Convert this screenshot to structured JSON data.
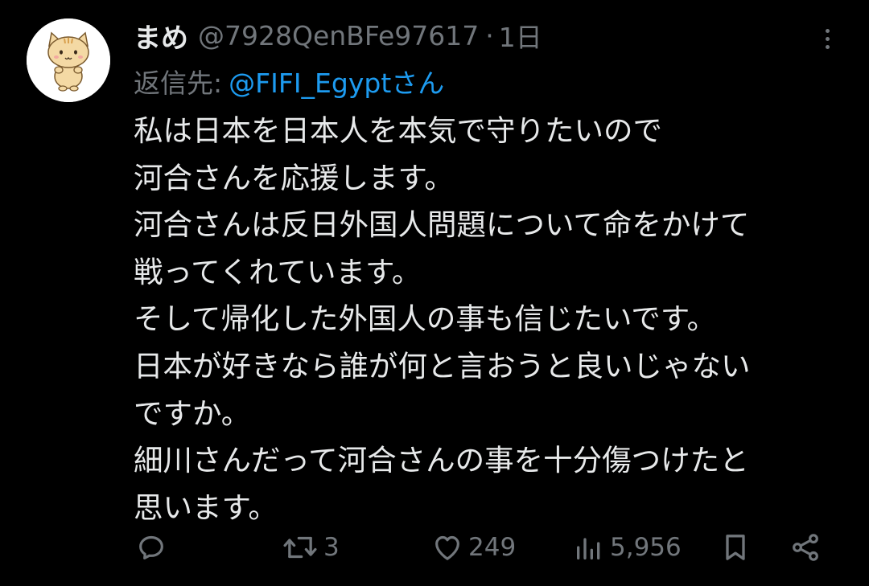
{
  "author": {
    "display_name": "まめ",
    "handle": "@7928QenBFe97617",
    "separator": "·",
    "time": "1日"
  },
  "reply": {
    "label": "返信先:",
    "user": "@FIFI_Egyptさん"
  },
  "body_lines": [
    "私は日本を日本人を本気で守りたいので",
    "河合さんを応援します。",
    "河合さんは反日外国人問題について命をかけて",
    "戦ってくれています。",
    "そして帰化した外国人の事も信じたいです。",
    "日本が好きなら誰が何と言おうと良いじゃない",
    "ですか。",
    "細川さんだって河合さんの事を十分傷つけたと",
    "思います。"
  ],
  "stats": {
    "replies": "",
    "retweets": "3",
    "likes": "249",
    "views": "5,956"
  },
  "icons": {
    "avatar": "cat-avatar-icon",
    "more": "more-vertical-icon",
    "reply": "reply-icon",
    "retweet": "retweet-icon",
    "like": "heart-icon",
    "views": "views-icon",
    "bookmark": "bookmark-icon",
    "share": "share-icon"
  },
  "colors": {
    "background": "#000000",
    "primary_text": "#e7e9ea",
    "secondary_text": "#71767b",
    "link": "#1d9bf0"
  }
}
